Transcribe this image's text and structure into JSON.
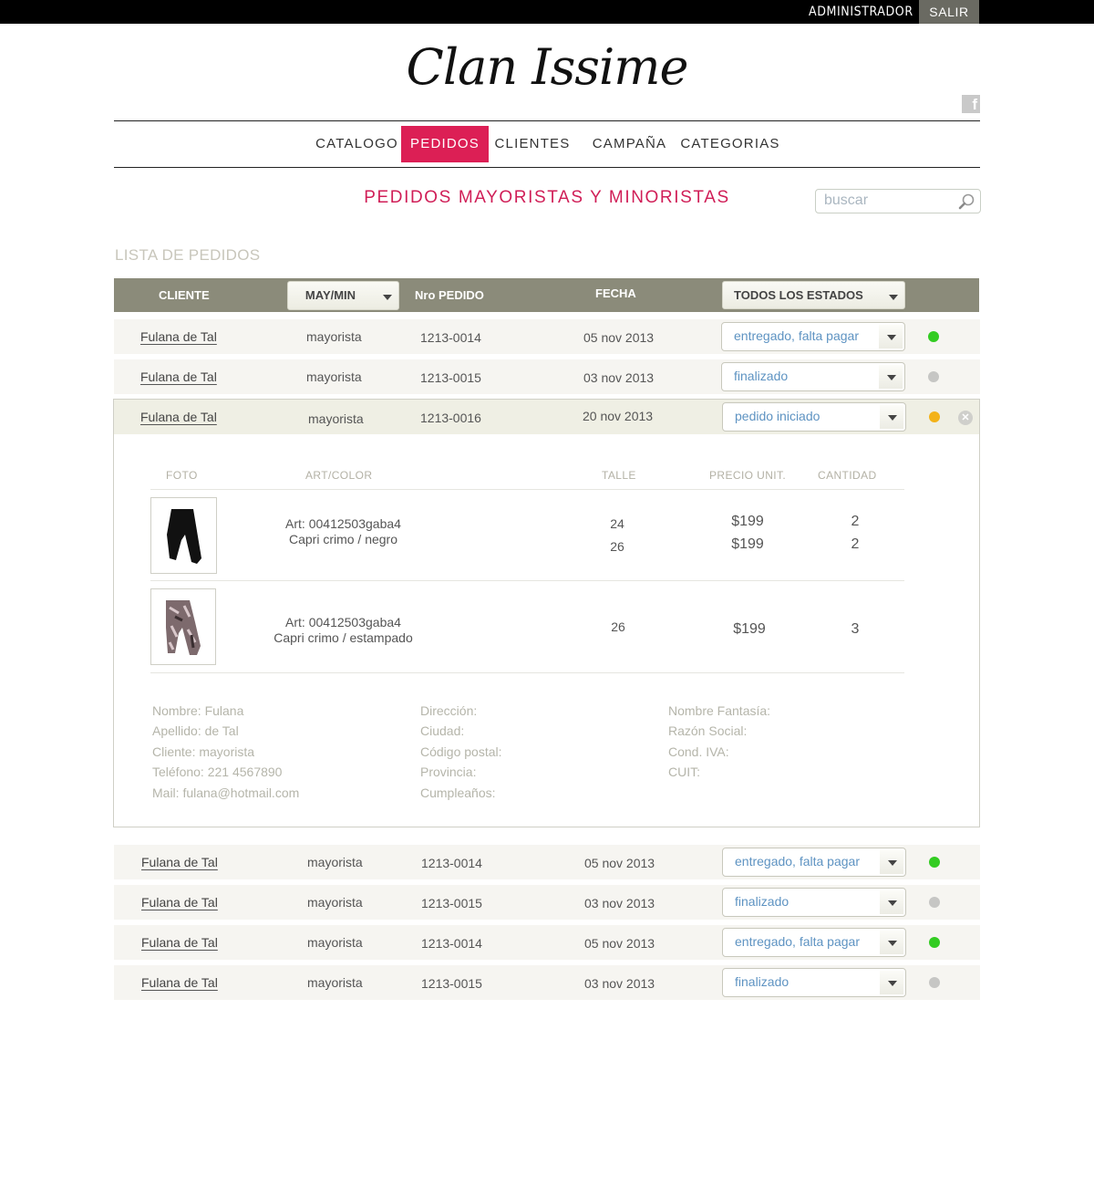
{
  "topbar": {
    "admin_label": "ADMINISTRADOR",
    "logout_label": "SALIR"
  },
  "brand": {
    "logo_text": "Clan Issime",
    "facebook_glyph": "f"
  },
  "nav": [
    "CATALOGO",
    "PEDIDOS",
    "CLIENTES",
    "CAMPAÑA",
    "CATEGORIAS"
  ],
  "nav_active": "PEDIDOS",
  "page_title": "PEDIDOS MAYORISTAS Y MINORISTAS",
  "search": {
    "placeholder": "buscar",
    "icon": "search-icon"
  },
  "list_title": "LISTA DE PEDIDOS",
  "table_header": {
    "client": "CLIENTE",
    "type_filter": "MAY/MIN",
    "order_no": "Nro PEDIDO",
    "date": "FECHA",
    "status_filter": "TODOS LOS ESTADOS"
  },
  "orders_top": [
    {
      "client": "Fulana de Tal",
      "type": "mayorista",
      "order_no": "1213-0014",
      "date": "05 nov 2013",
      "status": "entregado, falta pagar",
      "dot": "green"
    },
    {
      "client": "Fulana de Tal",
      "type": "mayorista",
      "order_no": "1213-0015",
      "date": "03 nov 2013",
      "status": "finalizado",
      "dot": "gray"
    }
  ],
  "expanded_order": {
    "client": "Fulana de Tal",
    "type": "mayorista",
    "order_no": "1213-0016",
    "date": "20 nov 2013",
    "status": "pedido iniciado",
    "dot": "orange",
    "detail_headers": {
      "photo": "FOTO",
      "art": "ART/COLOR",
      "size": "TALLE",
      "price": "PRECIO UNIT.",
      "qty": "CANTIDAD"
    },
    "items": [
      {
        "art": "Art: 00412503gaba4",
        "desc": "Capri crimo / negro",
        "sizes": [
          "24",
          "26"
        ],
        "prices": [
          "$199",
          "$199"
        ],
        "qtys": [
          "2",
          "2"
        ],
        "image": "black-capri-pants"
      },
      {
        "art": "Art: 00412503gaba4",
        "desc": "Capri crimo / estampado",
        "sizes": [
          "26"
        ],
        "prices": [
          "$199"
        ],
        "qtys": [
          "3"
        ],
        "image": "printed-capri-pants"
      }
    ],
    "customer": {
      "col1": [
        "Nombre: Fulana",
        "Apellido: de Tal",
        "Cliente: mayorista",
        "Teléfono: 221 4567890",
        "Mail: fulana@hotmail.com"
      ],
      "col2": [
        "Dirección:",
        "Ciudad:",
        "Código postal:",
        "Provincia:",
        "Cumpleaños:"
      ],
      "col3": [
        "Nombre Fantasía:",
        "Razón Social:",
        "Cond. IVA:",
        "CUIT:"
      ]
    }
  },
  "orders_bottom": [
    {
      "client": "Fulana de Tal",
      "type": "mayorista",
      "order_no": "1213-0014",
      "date": "05 nov 2013",
      "status": "entregado, falta pagar",
      "dot": "green"
    },
    {
      "client": "Fulana de Tal",
      "type": "mayorista",
      "order_no": "1213-0015",
      "date": "03 nov 2013",
      "status": "finalizado",
      "dot": "gray"
    },
    {
      "client": "Fulana de Tal",
      "type": "mayorista",
      "order_no": "1213-0014",
      "date": "05 nov 2013",
      "status": "entregado, falta pagar",
      "dot": "green"
    },
    {
      "client": "Fulana de Tal",
      "type": "mayorista",
      "order_no": "1213-0015",
      "date": "03 nov 2013",
      "status": "finalizado",
      "dot": "gray"
    }
  ],
  "colors": {
    "accent": "#dc1f55",
    "header_bg": "#8b8b7a",
    "row_bg": "#f6f5f1",
    "status_text": "#5e93c2",
    "dot_green": "#33cc22",
    "dot_gray": "#c6c6c4",
    "dot_orange": "#f3b219"
  }
}
